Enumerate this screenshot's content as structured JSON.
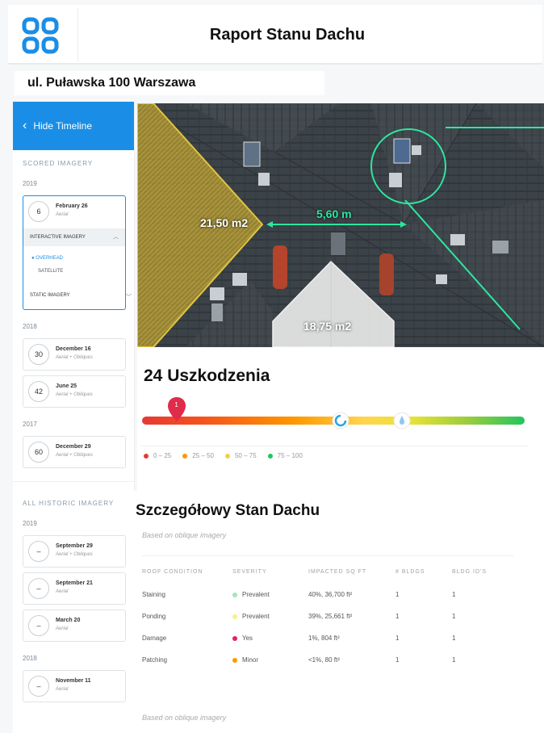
{
  "header": {
    "title": "Raport Stanu Dachu"
  },
  "address": "ul. Puławska 100 Warszawa",
  "sidebar": {
    "hide_timeline": "Hide Timeline",
    "scored_label": "SCORED IMAGERY",
    "active_year": "2019",
    "active_card": {
      "day": "6",
      "title": "February 26",
      "sub": "Aerial",
      "interactive": "INTERACTIVE IMAGERY",
      "option_selected": "OVERHEAD",
      "option_other": "SATELLITE",
      "static": "STATIC IMAGERY"
    },
    "year_2018": "2018",
    "cards_2018": [
      {
        "day": "30",
        "title": "December 16",
        "sub": "Aerial + Obliques"
      },
      {
        "day": "42",
        "title": "June 25",
        "sub": "Aerial + Obliques"
      }
    ],
    "year_2017": "2017",
    "cards_2017": [
      {
        "day": "60",
        "title": "December 29",
        "sub": "Aerial + Obliques"
      }
    ],
    "historic_label": "ALL HISTORIC IMAGERY",
    "hist_year_2019": "2019",
    "hist_cards_2019": [
      {
        "day": "–",
        "title": "September 29",
        "sub": "Aerial + Obliques"
      },
      {
        "day": "–",
        "title": "September 21",
        "sub": "Aerial"
      },
      {
        "day": "–",
        "title": "March 20",
        "sub": "Aerial"
      }
    ],
    "hist_year_2018": "2018",
    "hist_cards_2018": [
      {
        "day": "–",
        "title": "November 11",
        "sub": "Aerial"
      }
    ]
  },
  "roof": {
    "area_left": "21,50 m2",
    "area_bottom": "18,75 m2",
    "distance": "5,60 m",
    "colors": {
      "yellow": "#e6c53a",
      "green": "#2ee6a0",
      "white": "#e8e8e8"
    }
  },
  "damage": {
    "title": "24 Uszkodzenia",
    "marker_value": "1",
    "gauge_position": 0.09,
    "circle_position": 0.52,
    "drop_position": 0.68,
    "legend": [
      {
        "label": "0 – 25",
        "color": "#e53935"
      },
      {
        "label": "25 – 50",
        "color": "#ff9800"
      },
      {
        "label": "50 – 75",
        "color": "#f4d03f"
      },
      {
        "label": "75 – 100",
        "color": "#22c55e"
      }
    ]
  },
  "details": {
    "title": "Szczegółowy Stan Dachu",
    "based_on": "Based on oblique imagery",
    "based_on_bottom": "Based on oblique imagery",
    "columns": [
      "ROOF CONDITION",
      "SEVERITY",
      "IMPACTED SQ FT",
      "# BLDGS",
      "BLDG ID'S"
    ],
    "rows": [
      {
        "condition": "Staining",
        "severity": "Prevalent",
        "sev_color": "#a5e6b3",
        "impacted": "40%, 36,700 ft²",
        "bldgs": "1",
        "ids": "1"
      },
      {
        "condition": "Ponding",
        "severity": "Prevalent",
        "sev_color": "#f7ef8a",
        "impacted": "39%, 25,661 ft²",
        "bldgs": "1",
        "ids": "1"
      },
      {
        "condition": "Damage",
        "severity": "Yes",
        "sev_color": "#e0245e",
        "impacted": "1%, 804 ft²",
        "bldgs": "1",
        "ids": "1"
      },
      {
        "condition": "Patching",
        "severity": "Minor",
        "sev_color": "#ff9800",
        "impacted": "<1%, 80 ft²",
        "bldgs": "1",
        "ids": "1"
      }
    ]
  }
}
